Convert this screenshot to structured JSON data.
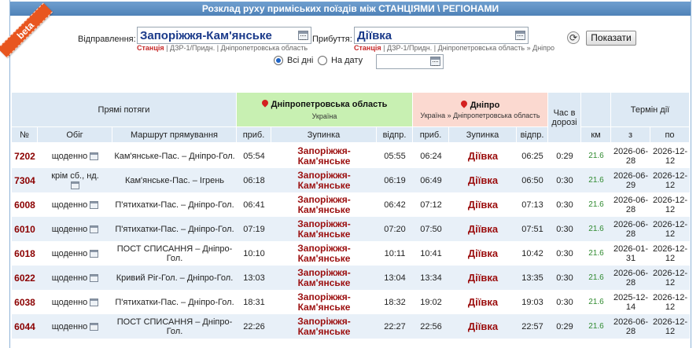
{
  "header": {
    "title": "Розклад руху приміських поїздів між СТАНЦІЯМИ \\ РЕГІОНАМИ"
  },
  "badge": {
    "beta": "beta"
  },
  "form": {
    "departure_label": "Відправлення:",
    "departure_value": "Запоріжжя-Кам'янське",
    "departure_hint_station": "Станція",
    "departure_hint_rest": "| ДЗР-1/Придн. | Дніпропетровська область",
    "arrival_label": "Прибуття:",
    "arrival_value": "Діївка",
    "arrival_hint_station": "Станція",
    "arrival_hint_rest": "| ДЗР-1/Придн. | Дніпропетровська область » Дніпро",
    "refresh_icon": "⟳",
    "show_button": "Показати",
    "all_days_label": "Всі дні",
    "on_date_label": "На дату",
    "date_value": "",
    "selected_mode": "all_days"
  },
  "table": {
    "group_direct": "Прямі потяги",
    "from_region": "Дніпропетровська область",
    "from_country": "Україна",
    "to_city": "Дніпро",
    "to_path": "Україна » Дніпропетровська область",
    "travel_time": "Час в дорозі",
    "validity": "Термін дії",
    "col_num": "№",
    "col_freq": "Обіг",
    "col_route": "Маршрут прямування",
    "col_arr": "приб.",
    "col_stop": "Зупинка",
    "col_dep": "відпр.",
    "col_km": "км",
    "col_from": "з",
    "col_to": "по",
    "rows": [
      {
        "num": "7202",
        "freq": "щоденно",
        "route": "Кам'янське-Пас. – Дніпро-Гол.",
        "arr1": "05:54",
        "stop1": "Запоріжжя-Кам'янське",
        "dep1": "05:55",
        "arr2": "06:24",
        "stop2": "Діївка",
        "dep2": "06:25",
        "time": "0:29",
        "km": "21.6",
        "from": "2026-06-28",
        "to": "2026-12-12"
      },
      {
        "num": "7304",
        "freq": "крім сб., нд.",
        "route": "Кам'янське-Пас. – Ігрень",
        "arr1": "06:18",
        "stop1": "Запоріжжя-Кам'янське",
        "dep1": "06:19",
        "arr2": "06:49",
        "stop2": "Діївка",
        "dep2": "06:50",
        "time": "0:30",
        "km": "21.6",
        "from": "2026-06-29",
        "to": "2026-12-12"
      },
      {
        "num": "6008",
        "freq": "щоденно",
        "route": "П'ятихатки-Пас. – Дніпро-Гол.",
        "arr1": "06:41",
        "stop1": "Запоріжжя-Кам'янське",
        "dep1": "06:42",
        "arr2": "07:12",
        "stop2": "Діївка",
        "dep2": "07:13",
        "time": "0:30",
        "km": "21.6",
        "from": "2026-06-28",
        "to": "2026-12-12"
      },
      {
        "num": "6010",
        "freq": "щоденно",
        "route": "П'ятихатки-Пас. – Дніпро-Гол.",
        "arr1": "07:19",
        "stop1": "Запоріжжя-Кам'янське",
        "dep1": "07:20",
        "arr2": "07:50",
        "stop2": "Діївка",
        "dep2": "07:51",
        "time": "0:30",
        "km": "21.6",
        "from": "2026-06-28",
        "to": "2026-12-12"
      },
      {
        "num": "6018",
        "freq": "щоденно",
        "route": "ПОСТ СПИСАННЯ – Дніпро-Гол.",
        "arr1": "10:10",
        "stop1": "Запоріжжя-Кам'янське",
        "dep1": "10:11",
        "arr2": "10:41",
        "stop2": "Діївка",
        "dep2": "10:42",
        "time": "0:30",
        "km": "21.6",
        "from": "2026-01-31",
        "to": "2026-12-12"
      },
      {
        "num": "6022",
        "freq": "щоденно",
        "route": "Кривий Ріг-Гол. – Дніпро-Гол.",
        "arr1": "13:03",
        "stop1": "Запоріжжя-Кам'янське",
        "dep1": "13:04",
        "arr2": "13:34",
        "stop2": "Діївка",
        "dep2": "13:35",
        "time": "0:30",
        "km": "21.6",
        "from": "2026-06-28",
        "to": "2026-12-12"
      },
      {
        "num": "6038",
        "freq": "щоденно",
        "route": "П'ятихатки-Пас. – Дніпро-Гол.",
        "arr1": "18:31",
        "stop1": "Запоріжжя-Кам'янське",
        "dep1": "18:32",
        "arr2": "19:02",
        "stop2": "Діївка",
        "dep2": "19:03",
        "time": "0:30",
        "km": "21.6",
        "from": "2025-12-14",
        "to": "2026-12-12"
      },
      {
        "num": "6044",
        "freq": "щоденно",
        "route": "ПОСТ СПИСАННЯ – Дніпро-Гол.",
        "arr1": "22:26",
        "stop1": "Запоріжжя-Кам'янське",
        "dep1": "22:27",
        "arr2": "22:56",
        "stop2": "Діївка",
        "dep2": "22:57",
        "time": "0:29",
        "km": "21.6",
        "from": "2026-06-28",
        "to": "2026-12-12"
      }
    ]
  },
  "colors": {
    "title_bar": "#4f82b8",
    "header_blue": "#dde9f4",
    "header_green": "#c8f0b2",
    "header_pink": "#fbd9d0",
    "row_alt": "#e8f0f8",
    "train_number": "#8b0000",
    "km_green": "#2f8a2f"
  }
}
